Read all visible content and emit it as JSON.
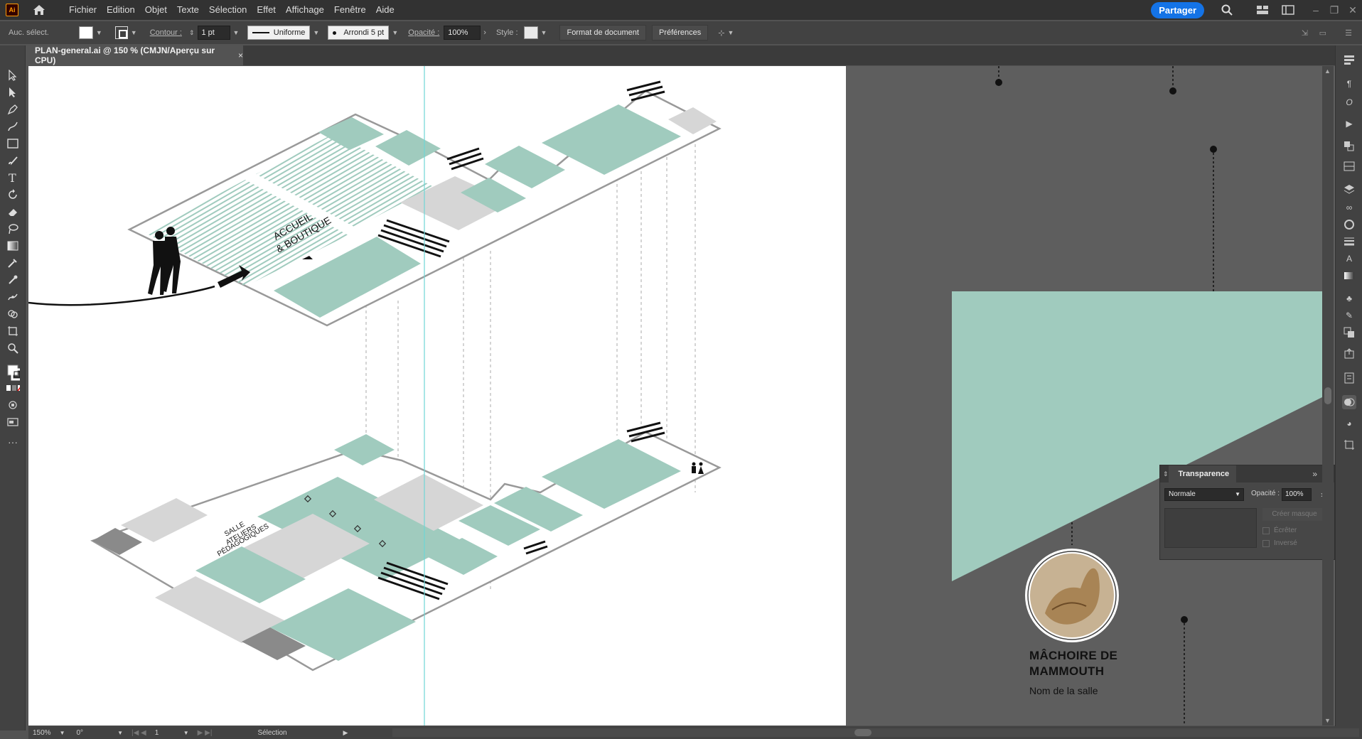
{
  "app": {
    "logo_text": "Ai",
    "menu": [
      "Fichier",
      "Edition",
      "Objet",
      "Texte",
      "Sélection",
      "Effet",
      "Affichage",
      "Fenêtre",
      "Aide"
    ],
    "share_label": "Partager"
  },
  "control_bar": {
    "selection_label": "Auc. sélect.",
    "contour_label": "Contour :",
    "stroke_weight": "1 pt",
    "profile_label": "Uniforme",
    "brush_label": "Arrondi 5 pt",
    "opacity_label": "Opacité :",
    "opacity_value": "100%",
    "style_label": "Style :",
    "doc_format_button": "Format de document",
    "prefs_button": "Préférences"
  },
  "document": {
    "tab_title": "PLAN-general.ai @ 150 % (CMJN/Aperçu sur CPU)",
    "tab_close": "×"
  },
  "artwork": {
    "label_accueil_1": "ACCUEIL",
    "label_accueil_2": "& BOUTIQUE",
    "label_salle_1": "SALLE",
    "label_salle_2": "ATELIERS",
    "label_salle_3": "PÉDAGOGIQUES",
    "mammoth_title_1": "MÂCHOIRE DE",
    "mammoth_title_2": "MAMMOUTH",
    "mammoth_subtitle": "Nom de la salle",
    "accent_color": "#a0cbbe",
    "gray_color": "#d6d6d6",
    "dark_gray_color": "#8a8a8a"
  },
  "transparency_panel": {
    "title": "Transparence",
    "blend_mode": "Normale",
    "opacity_label": "Opacité :",
    "opacity_value": "100%",
    "mask_button": "Créer masque",
    "clip_label": "Écrêter",
    "invert_label": "Inversé"
  },
  "status_bar": {
    "zoom": "150%",
    "rotation": "0°",
    "artboard_number": "1",
    "tool_status": "Sélection"
  }
}
